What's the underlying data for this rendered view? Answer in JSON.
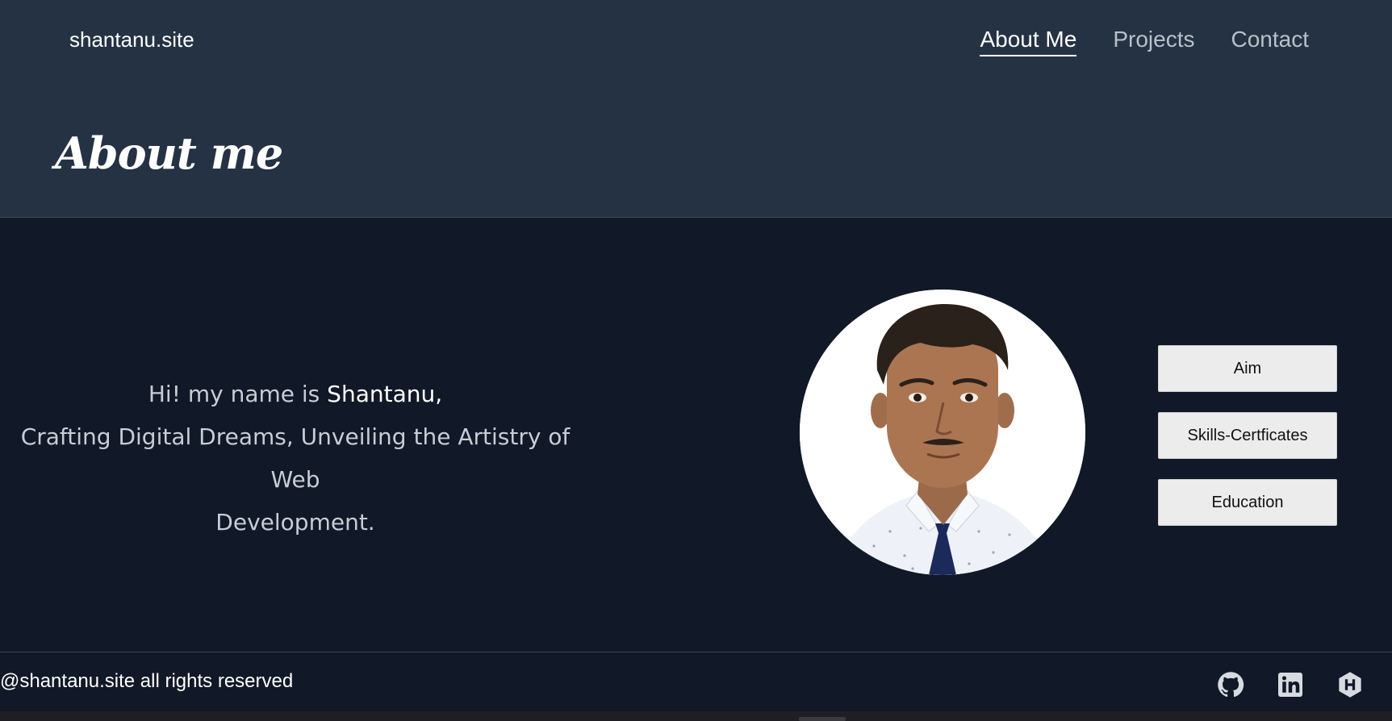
{
  "header": {
    "brand": "shantanu.site",
    "nav": [
      "About Me",
      "Projects",
      "Contact"
    ],
    "page_title": "About me"
  },
  "intro": {
    "greeting": "Hi! my name is",
    "name": "Shantanu,",
    "tagline_line1": "Crafting Digital Dreams, Unveiling the Artistry of Web",
    "tagline_line2": "Development."
  },
  "profile": {
    "photo_icon": "profile-photo"
  },
  "side_buttons": [
    "Aim",
    "Skills-Certficates",
    "Education"
  ],
  "footer": {
    "copyright": "@shantanu.site all rights reserved",
    "social_icons": [
      "github-icon",
      "linkedin-icon",
      "hashnode-icon"
    ]
  },
  "colors": {
    "header_bg": "#243244",
    "page_bg": "#111827",
    "button_bg": "#ececec",
    "tie": "#1b2a5a"
  }
}
